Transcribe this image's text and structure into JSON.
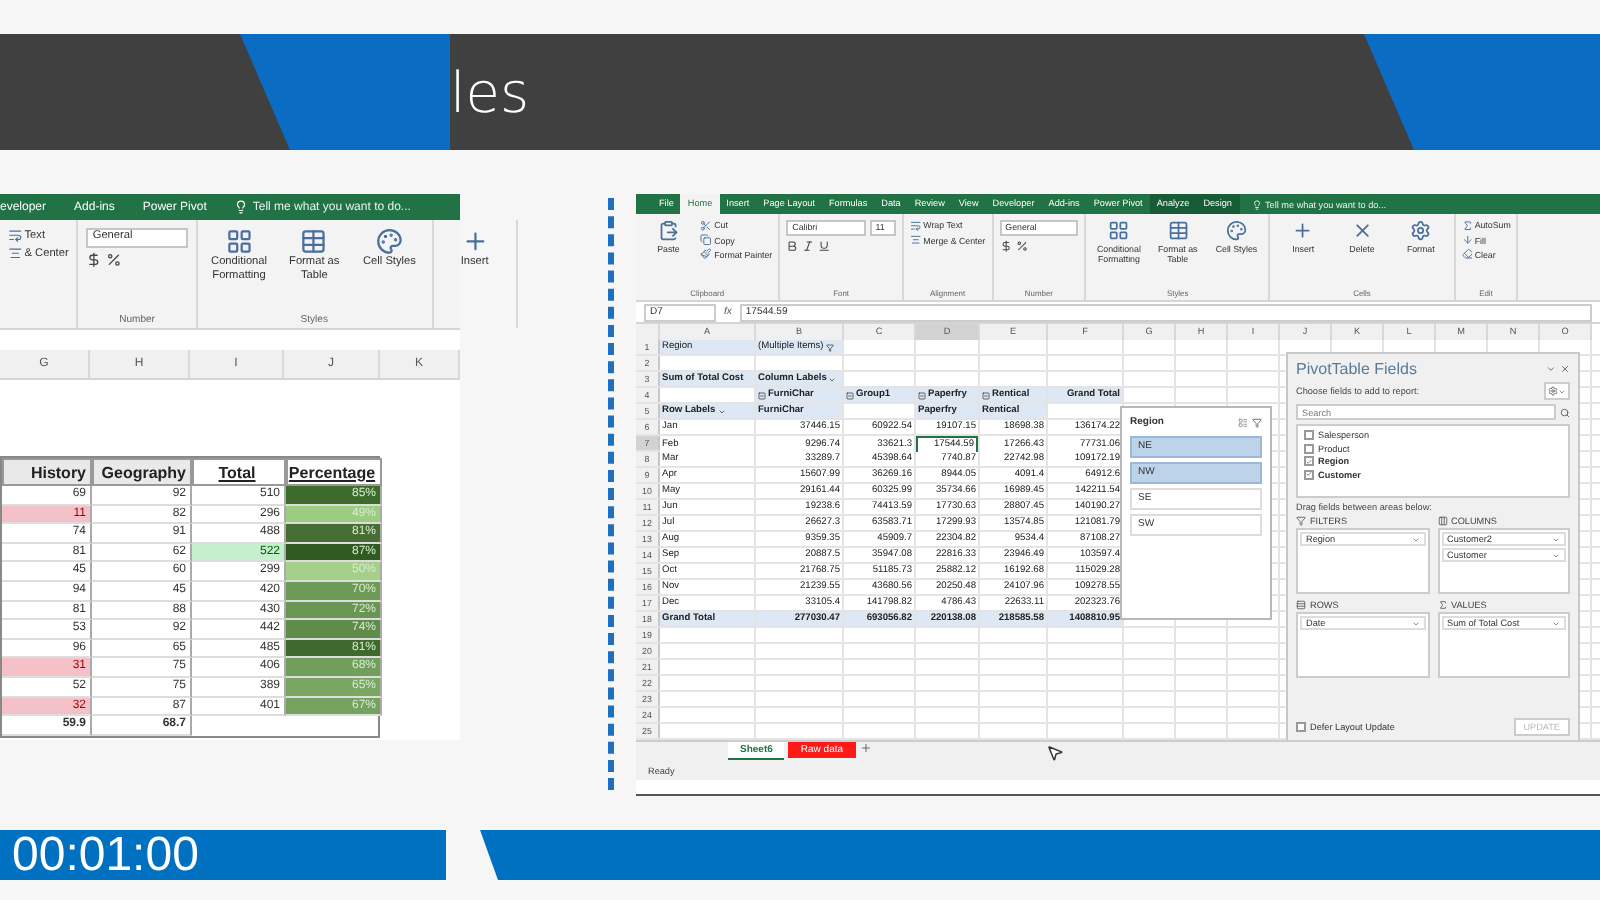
{
  "slide": {
    "title": "les",
    "timer": "00:01:00"
  },
  "left_excel": {
    "tabs": [
      "eveloper",
      "Add-ins",
      "Power Pivot"
    ],
    "tell_me": "Tell me what you want to do...",
    "ribbon": [
      {
        "kind": "alignment",
        "small": [
          {
            "label": "Text",
            "kind": "wrap"
          },
          {
            "label": "& Center",
            "kind": "merge"
          }
        ]
      },
      {
        "kind": "number",
        "name": "Number",
        "fields": [
          "General"
        ]
      },
      {
        "kind": "styles",
        "name": "Styles",
        "big": [
          {
            "label": "Conditional Formatting",
            "kind": "conditional"
          },
          {
            "label": "Format as Table",
            "kind": "table"
          },
          {
            "label": "Cell Styles",
            "kind": "styles"
          }
        ]
      },
      {
        "kind": "cells",
        "big": [
          {
            "label": "Insert",
            "kind": "insert"
          }
        ]
      }
    ],
    "columns": [
      "G",
      "H",
      "I",
      "J",
      "K"
    ],
    "headers": [
      "History",
      "Geography",
      "Total",
      "Percentage"
    ],
    "rows": [
      {
        "history": "69",
        "history_low": false,
        "geography": "92",
        "total": "510",
        "total_high": false,
        "percentage": "85%",
        "color": "#3d6b2c"
      },
      {
        "history": "11",
        "history_low": true,
        "geography": "82",
        "total": "296",
        "total_high": false,
        "percentage": "49%",
        "color": "#9ccc7f"
      },
      {
        "history": "74",
        "history_low": false,
        "geography": "91",
        "total": "488",
        "total_high": false,
        "percentage": "81%",
        "color": "#476f33"
      },
      {
        "history": "81",
        "history_low": false,
        "geography": "62",
        "total": "522",
        "total_high": true,
        "percentage": "87%",
        "color": "#2f5a22"
      },
      {
        "history": "45",
        "history_low": false,
        "geography": "60",
        "total": "299",
        "total_high": false,
        "percentage": "50%",
        "color": "#a4d08a"
      },
      {
        "history": "94",
        "history_low": false,
        "geography": "45",
        "total": "420",
        "total_high": false,
        "percentage": "70%",
        "color": "#6d9a57"
      },
      {
        "history": "81",
        "history_low": false,
        "geography": "88",
        "total": "430",
        "total_high": false,
        "percentage": "72%",
        "color": "#6a9554"
      },
      {
        "history": "53",
        "history_low": false,
        "geography": "92",
        "total": "442",
        "total_high": false,
        "percentage": "74%",
        "color": "#5f8c4b"
      },
      {
        "history": "96",
        "history_low": false,
        "geography": "65",
        "total": "485",
        "total_high": false,
        "percentage": "81%",
        "color": "#3f6a2e"
      },
      {
        "history": "31",
        "history_low": true,
        "geography": "75",
        "total": "406",
        "total_high": false,
        "percentage": "68%",
        "color": "#729e5c"
      },
      {
        "history": "52",
        "history_low": false,
        "geography": "75",
        "total": "389",
        "total_high": false,
        "percentage": "65%",
        "color": "#7aa664"
      },
      {
        "history": "32",
        "history_low": true,
        "geography": "87",
        "total": "401",
        "total_high": false,
        "percentage": "67%",
        "color": "#75a25f"
      }
    ],
    "averages": [
      "59.9",
      "68.7"
    ]
  },
  "excel": {
    "tabs": [
      {
        "label": "File",
        "selected": false,
        "kind": "normal"
      },
      {
        "label": "Home",
        "selected": true,
        "kind": "normal"
      },
      {
        "label": "Insert",
        "selected": false,
        "kind": "normal"
      },
      {
        "label": "Page Layout",
        "selected": false,
        "kind": "normal"
      },
      {
        "label": "Formulas",
        "selected": false,
        "kind": "normal"
      },
      {
        "label": "Data",
        "selected": false,
        "kind": "normal"
      },
      {
        "label": "Review",
        "selected": false,
        "kind": "normal"
      },
      {
        "label": "View",
        "selected": false,
        "kind": "normal"
      },
      {
        "label": "Developer",
        "selected": false,
        "kind": "normal"
      },
      {
        "label": "Add-ins",
        "selected": false,
        "kind": "normal"
      },
      {
        "label": "Power Pivot",
        "selected": false,
        "kind": "normal"
      },
      {
        "label": "Analyze",
        "selected": false,
        "kind": "contextual"
      },
      {
        "label": "Design",
        "selected": false,
        "kind": "contextual"
      }
    ],
    "tell_me": "Tell me what you want to do...",
    "ribbon": [
      {
        "kind": "clipboard",
        "name": "Clipboard",
        "big": [
          {
            "label": "Paste",
            "kind": "paste"
          }
        ],
        "small": [
          {
            "label": "Cut",
            "kind": "cut"
          },
          {
            "label": "Copy",
            "kind": "copy"
          },
          {
            "label": "Format Painter",
            "kind": "painter"
          }
        ]
      },
      {
        "kind": "font",
        "name": "Font",
        "fields": [
          "Calibri",
          "11"
        ]
      },
      {
        "kind": "alignment",
        "name": "Alignment",
        "small": [
          {
            "label": "Wrap Text",
            "kind": "wrap"
          },
          {
            "label": "Merge & Center",
            "kind": "merge"
          }
        ]
      },
      {
        "kind": "number",
        "name": "Number",
        "fields": [
          "General"
        ]
      },
      {
        "kind": "styles",
        "name": "Styles",
        "big": [
          {
            "label": "Conditional Formatting",
            "kind": "conditional"
          },
          {
            "label": "Format as Table",
            "kind": "table"
          },
          {
            "label": "Cell Styles",
            "kind": "styles"
          }
        ]
      },
      {
        "kind": "cells",
        "name": "Cells",
        "big": [
          {
            "label": "Insert",
            "kind": "insert"
          },
          {
            "label": "Delete",
            "kind": "delete"
          },
          {
            "label": "Format",
            "kind": "format"
          }
        ]
      },
      {
        "kind": "editing",
        "name": "Edit",
        "small": [
          {
            "label": "AutoSum",
            "kind": "sum"
          },
          {
            "label": "Fill",
            "kind": "fill"
          },
          {
            "label": "Clear",
            "kind": "clear"
          }
        ]
      }
    ],
    "name_box": "D7",
    "function_label": "fx",
    "formula": "17544.59",
    "columns": [
      "A",
      "B",
      "C",
      "D",
      "E",
      "F",
      "G",
      "H",
      "I",
      "J",
      "K",
      "L",
      "M",
      "N",
      "O"
    ],
    "row_numbers": [
      "1",
      "2",
      "3",
      "4",
      "5",
      "6",
      "7",
      "8",
      "9",
      "10",
      "11",
      "12",
      "13",
      "14",
      "15",
      "16",
      "17",
      "18",
      "19",
      "20",
      "21",
      "22",
      "23",
      "24",
      "25"
    ],
    "pivot": {
      "filter_field": "Region",
      "filter_value": "(Multiple Items)",
      "value_field": "Sum of Total Cost",
      "column_labels": "Column Labels",
      "groups": [
        {
          "text": "FurniChar",
          "collapsible": true
        },
        {
          "text": "Group1",
          "collapsible": true
        },
        {
          "text": "Paperfry",
          "collapsible": true
        },
        {
          "text": "Rentical",
          "collapsible": true
        },
        {
          "text": "Grand Total",
          "collapsible": false
        }
      ],
      "row_labels": "Row Labels",
      "subheaders": [
        {
          "kind": "text",
          "text": "FurniChar"
        },
        {
          "kind": "empty"
        },
        {
          "kind": "text",
          "text": "Paperfry"
        },
        {
          "kind": "text",
          "text": "Rentical"
        }
      ],
      "rows": [
        {
          "label": "Jan",
          "cells": [
            {
              "text": "37446.15",
              "selected": false
            },
            {
              "text": "60922.54",
              "selected": false
            },
            {
              "text": "19107.15",
              "selected": false
            },
            {
              "text": "18698.38",
              "selected": false
            },
            {
              "text": "136174.22",
              "selected": false
            }
          ]
        },
        {
          "label": "Feb",
          "cells": [
            {
              "text": "9296.74",
              "selected": false
            },
            {
              "text": "33621.3",
              "selected": false
            },
            {
              "text": "17544.59",
              "selected": true
            },
            {
              "text": "17266.43",
              "selected": false
            },
            {
              "text": "77731.06",
              "selected": false
            }
          ]
        },
        {
          "label": "Mar",
          "cells": [
            {
              "text": "33289.7",
              "selected": false
            },
            {
              "text": "45398.64",
              "selected": false
            },
            {
              "text": "7740.87",
              "selected": false
            },
            {
              "text": "22742.98",
              "selected": false
            },
            {
              "text": "109172.19",
              "selected": false
            }
          ]
        },
        {
          "label": "Apr",
          "cells": [
            {
              "text": "15607.99",
              "selected": false
            },
            {
              "text": "36269.16",
              "selected": false
            },
            {
              "text": "8944.05",
              "selected": false
            },
            {
              "text": "4091.4",
              "selected": false
            },
            {
              "text": "64912.6",
              "selected": false
            }
          ]
        },
        {
          "label": "May",
          "cells": [
            {
              "text": "29161.44",
              "selected": false
            },
            {
              "text": "60325.99",
              "selected": false
            },
            {
              "text": "35734.66",
              "selected": false
            },
            {
              "text": "16989.45",
              "selected": false
            },
            {
              "text": "142211.54",
              "selected": false
            }
          ]
        },
        {
          "label": "Jun",
          "cells": [
            {
              "text": "19238.6",
              "selected": false
            },
            {
              "text": "74413.59",
              "selected": false
            },
            {
              "text": "17730.63",
              "selected": false
            },
            {
              "text": "28807.45",
              "selected": false
            },
            {
              "text": "140190.27",
              "selected": false
            }
          ]
        },
        {
          "label": "Jul",
          "cells": [
            {
              "text": "26627.3",
              "selected": false
            },
            {
              "text": "63583.71",
              "selected": false
            },
            {
              "text": "17299.93",
              "selected": false
            },
            {
              "text": "13574.85",
              "selected": false
            },
            {
              "text": "121081.79",
              "selected": false
            }
          ]
        },
        {
          "label": "Aug",
          "cells": [
            {
              "text": "9359.35",
              "selected": false
            },
            {
              "text": "45909.7",
              "selected": false
            },
            {
              "text": "22304.82",
              "selected": false
            },
            {
              "text": "9534.4",
              "selected": false
            },
            {
              "text": "87108.27",
              "selected": false
            }
          ]
        },
        {
          "label": "Sep",
          "cells": [
            {
              "text": "20887.5",
              "selected": false
            },
            {
              "text": "35947.08",
              "selected": false
            },
            {
              "text": "22816.33",
              "selected": false
            },
            {
              "text": "23946.49",
              "selected": false
            },
            {
              "text": "103597.4",
              "selected": false
            }
          ]
        },
        {
          "label": "Oct",
          "cells": [
            {
              "text": "21768.75",
              "selected": false
            },
            {
              "text": "51185.73",
              "selected": false
            },
            {
              "text": "25882.12",
              "selected": false
            },
            {
              "text": "16192.68",
              "selected": false
            },
            {
              "text": "115029.28",
              "selected": false
            }
          ]
        },
        {
          "label": "Nov",
          "cells": [
            {
              "text": "21239.55",
              "selected": false
            },
            {
              "text": "43680.56",
              "selected": false
            },
            {
              "text": "20250.48",
              "selected": false
            },
            {
              "text": "24107.96",
              "selected": false
            },
            {
              "text": "109278.55",
              "selected": false
            }
          ]
        },
        {
          "label": "Dec",
          "cells": [
            {
              "text": "33105.4",
              "selected": false
            },
            {
              "text": "141798.82",
              "selected": false
            },
            {
              "text": "4786.43",
              "selected": false
            },
            {
              "text": "22633.11",
              "selected": false
            },
            {
              "text": "202323.76",
              "selected": false
            }
          ]
        }
      ],
      "total": {
        "label": "Grand Total",
        "values": [
          "277030.47",
          "693056.82",
          "220138.08",
          "218585.58",
          "1408810.95"
        ]
      }
    },
    "slicer": {
      "title": "Region",
      "items": [
        {
          "label": "NE",
          "selected": true
        },
        {
          "label": "NW",
          "selected": true
        },
        {
          "label": "SE",
          "selected": false
        },
        {
          "label": "SW",
          "selected": false
        }
      ]
    },
    "fields_pane": {
      "title": "PivotTable Fields",
      "hint": "Choose fields to add to report:",
      "search": {
        "placeholder": "Search"
      },
      "fields": [
        {
          "name": "Salesperson",
          "checked": false
        },
        {
          "name": "Product",
          "checked": false
        },
        {
          "name": "Region",
          "checked": true
        },
        {
          "name": "Customer",
          "checked": true
        }
      ],
      "drag_hint": "Drag fields between areas below:",
      "areas": [
        {
          "label": "FILTERS",
          "kind": "filters",
          "items": [
            "Region"
          ]
        },
        {
          "label": "COLUMNS",
          "kind": "columns",
          "items": [
            "Customer2",
            "Customer"
          ]
        },
        {
          "label": "ROWS",
          "kind": "rows",
          "items": [
            "Date"
          ]
        },
        {
          "label": "VALUES",
          "kind": "values",
          "items": [
            "Sum of Total Cost"
          ]
        }
      ],
      "defer": {
        "label": "Defer Layout Update",
        "checked": false
      },
      "update": {
        "label": "UPDATE",
        "disabled": true
      }
    },
    "sheets": [
      {
        "label": "Sheet6",
        "selected": true,
        "color": "#ffffff"
      },
      {
        "label": "Raw data",
        "selected": false,
        "color": "#ff1a1a"
      }
    ],
    "status": "Ready"
  }
}
